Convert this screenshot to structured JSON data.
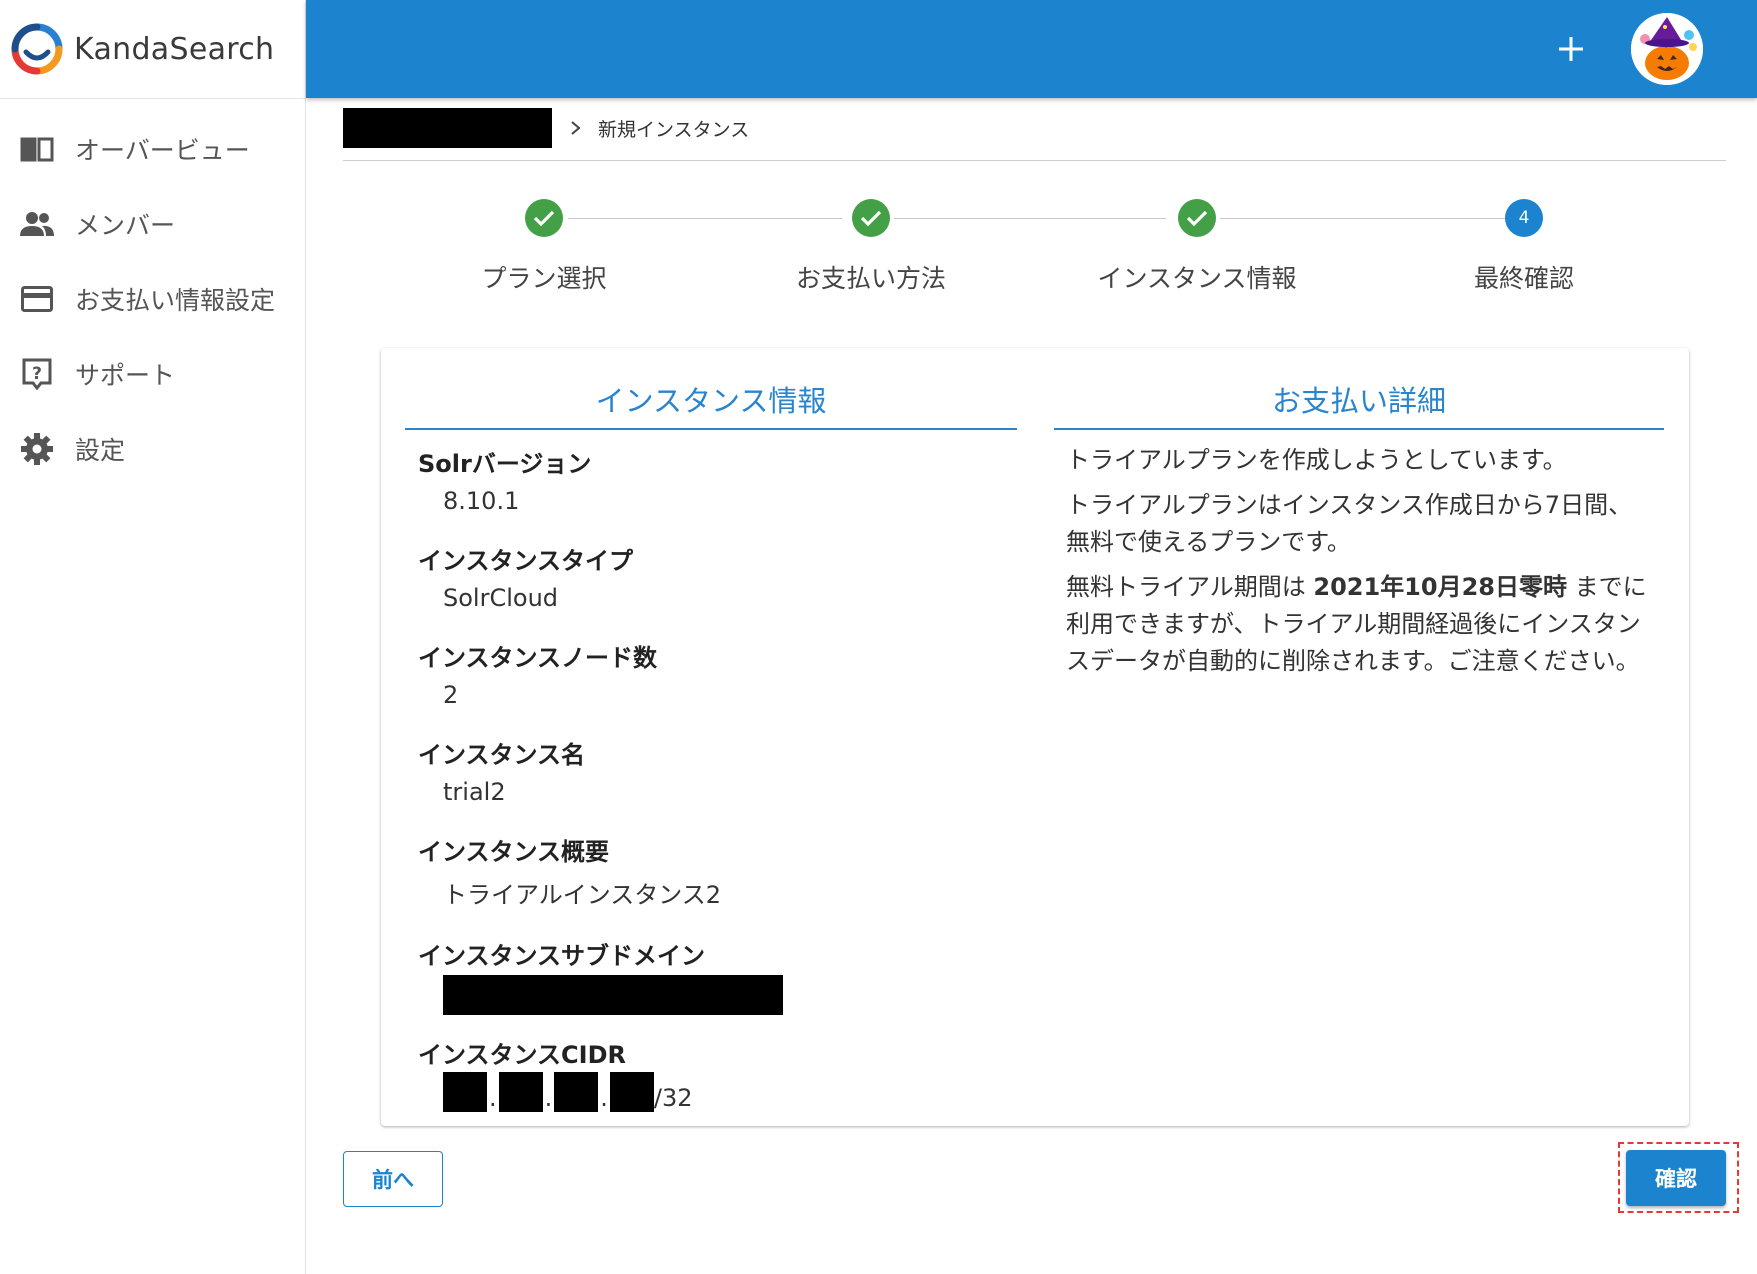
{
  "brand": {
    "name": "KandaSearch"
  },
  "sidebar": {
    "items": [
      {
        "label": "オーバービュー",
        "icon": "book-open-icon"
      },
      {
        "label": "メンバー",
        "icon": "people-icon"
      },
      {
        "label": "お支払い情報設定",
        "icon": "credit-card-icon"
      },
      {
        "label": "サポート",
        "icon": "help-box-icon"
      },
      {
        "label": "設定",
        "icon": "gear-icon"
      }
    ]
  },
  "header": {
    "add_icon": "plus-icon",
    "avatar_icon": "pumpkin-avatar-icon"
  },
  "breadcrumb": {
    "current": "新規インスタンス"
  },
  "stepper": {
    "steps": [
      {
        "label": "プラン選択",
        "state": "done"
      },
      {
        "label": "お支払い方法",
        "state": "done"
      },
      {
        "label": "インスタンス情報",
        "state": "done"
      },
      {
        "label": "最終確認",
        "state": "active",
        "number": "4"
      }
    ]
  },
  "instance": {
    "title": "インスタンス情報",
    "fields": [
      {
        "label": "Solrバージョン",
        "value": "8.10.1"
      },
      {
        "label": "インスタンスタイプ",
        "value": "SolrCloud"
      },
      {
        "label": "インスタンスノード数",
        "value": "2"
      },
      {
        "label": "インスタンス名",
        "value": "trial2"
      },
      {
        "label": "インスタンス概要",
        "value": "トライアルインスタンス2"
      },
      {
        "label": "インスタンスサブドメイン"
      },
      {
        "label": "インスタンスCIDR",
        "suffix": "/32"
      }
    ]
  },
  "payment": {
    "title": "お支払い詳細",
    "p1": "トライアルプランを作成しようとしています。",
    "p2": "トライアルプランはインスタンス作成日から7日間、無料で使えるプランです。",
    "p3_pre": "無料トライアル期間は ",
    "p3_bold": "2021年10月28日零時",
    "p3_post": " までに利用できますが、トライアル期間経過後にインスタンスデータが自動的に削除されます。ご注意ください。"
  },
  "actions": {
    "prev": "前へ",
    "confirm": "確認"
  },
  "colors": {
    "primary": "#1c84cf",
    "success": "#43a047",
    "highlight": "#e53935"
  }
}
